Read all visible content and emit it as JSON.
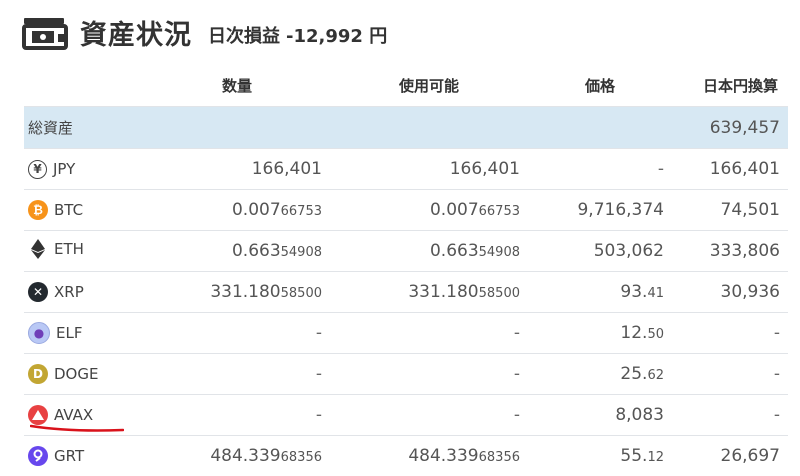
{
  "header": {
    "title": "資産状況",
    "pnl_label": "日次損益",
    "pnl_value": "-12,992 円"
  },
  "columns": {
    "quantity": "数量",
    "available": "使用可能",
    "price": "価格",
    "jpy_value": "日本円換算"
  },
  "total": {
    "label": "総資産",
    "value": "639,457"
  },
  "rows": [
    {
      "symbol": "JPY",
      "icon": "yen-icon",
      "qty_main": "166,401",
      "qty_small": "",
      "avail_main": "166,401",
      "avail_small": "",
      "price_main": "-",
      "price_small": "",
      "jpy": "166,401"
    },
    {
      "symbol": "BTC",
      "icon": "bitcoin-icon",
      "qty_main": "0.007",
      "qty_small": "66753",
      "avail_main": "0.007",
      "avail_small": "66753",
      "price_main": "9,716,374",
      "price_small": "",
      "jpy": "74,501"
    },
    {
      "symbol": "ETH",
      "icon": "ethereum-icon",
      "qty_main": "0.663",
      "qty_small": "54908",
      "avail_main": "0.663",
      "avail_small": "54908",
      "price_main": "503,062",
      "price_small": "",
      "jpy": "333,806"
    },
    {
      "symbol": "XRP",
      "icon": "xrp-icon",
      "qty_main": "331.180",
      "qty_small": "58500",
      "avail_main": "331.180",
      "avail_small": "58500",
      "price_main": "93.",
      "price_small": "41",
      "jpy": "30,936"
    },
    {
      "symbol": "ELF",
      "icon": "elf-icon",
      "qty_main": "-",
      "qty_small": "",
      "avail_main": "-",
      "avail_small": "",
      "price_main": "12.",
      "price_small": "50",
      "jpy": "-"
    },
    {
      "symbol": "DOGE",
      "icon": "doge-icon",
      "qty_main": "-",
      "qty_small": "",
      "avail_main": "-",
      "avail_small": "",
      "price_main": "25.",
      "price_small": "62",
      "jpy": "-"
    },
    {
      "symbol": "AVAX",
      "icon": "avax-icon",
      "qty_main": "-",
      "qty_small": "",
      "avail_main": "-",
      "avail_small": "",
      "price_main": "8,083",
      "price_small": "",
      "jpy": "-"
    },
    {
      "symbol": "GRT",
      "icon": "graph-icon",
      "qty_main": "484.339",
      "qty_small": "68356",
      "avail_main": "484.339",
      "avail_small": "68356",
      "price_main": "55.",
      "price_small": "12",
      "jpy": "26,697"
    }
  ],
  "colors": {
    "total_row_bg": "#d7e8f3",
    "btc": "#f7931a",
    "xrp": "#23292f",
    "avax": "#e84142",
    "doge": "#c2a633",
    "graph": "#6747ed",
    "annotation": "#d9121b"
  }
}
